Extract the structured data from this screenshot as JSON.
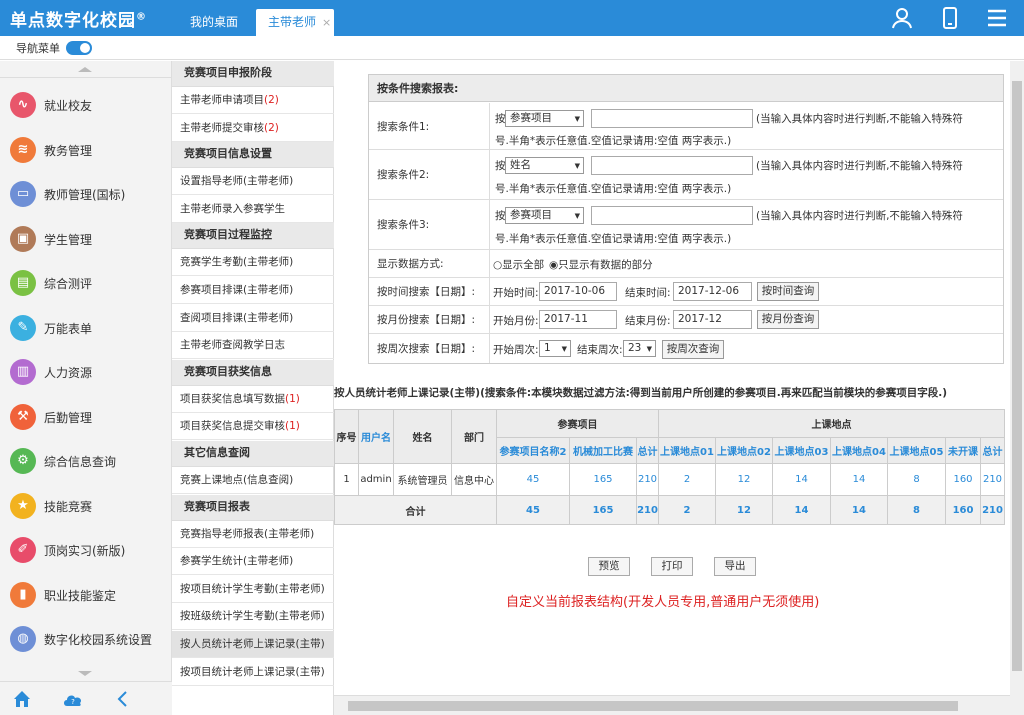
{
  "header": {
    "app_name": "单点数字化校园",
    "reg_mark": "®",
    "tabs": [
      {
        "label": "我的桌面"
      },
      {
        "label": "主带老师",
        "close": "×"
      }
    ],
    "icons": [
      "user-icon",
      "phone-icon",
      "menu-icon"
    ],
    "accent": "#2a8bd8"
  },
  "subbar": {
    "nav_label": "导航菜单"
  },
  "sidebar": {
    "items": [
      {
        "label": "就业校友",
        "icon": "chart-line-icon",
        "color": "#e8566b"
      },
      {
        "label": "教务管理",
        "icon": "layers-icon",
        "color": "#f07a3a"
      },
      {
        "label": "教师管理(国标)",
        "icon": "book-icon",
        "color": "#6e8fd6"
      },
      {
        "label": "学生管理",
        "icon": "student-icon",
        "color": "#b07a58"
      },
      {
        "label": "综合测评",
        "icon": "clipboard-icon",
        "color": "#7ac143"
      },
      {
        "label": "万能表单",
        "icon": "form-icon",
        "color": "#3bb0e0"
      },
      {
        "label": "人力资源",
        "icon": "briefcase-icon",
        "color": "#b36bd0"
      },
      {
        "label": "后勤管理",
        "icon": "wrench-icon",
        "color": "#f0623a"
      },
      {
        "label": "综合信息查询",
        "icon": "gear-icon",
        "color": "#56b854"
      },
      {
        "label": "技能竞赛",
        "icon": "medal-icon",
        "color": "#f2b21f"
      },
      {
        "label": "顶岗实习(新版)",
        "icon": "edit-icon",
        "color": "#e84c6a"
      },
      {
        "label": "职业技能鉴定",
        "icon": "bar-chart-icon",
        "color": "#f07a3a"
      },
      {
        "label": "数字化校园系统设置",
        "icon": "settings-icon",
        "color": "#6e8fd6"
      }
    ],
    "footer_icons": [
      "home-icon",
      "cloud-help-icon",
      "collapse-icon"
    ]
  },
  "submenu": {
    "groups": [
      {
        "title": "竞赛项目申报阶段",
        "items": [
          {
            "label": "主带老师申请项目",
            "count": "(2)"
          },
          {
            "label": "主带老师提交审核",
            "count": "(2)"
          }
        ]
      },
      {
        "title": "竞赛项目信息设置",
        "items": [
          {
            "label": "设置指导老师(主带老师)",
            "count": ""
          },
          {
            "label": "主带老师录入参赛学生",
            "count": ""
          }
        ]
      },
      {
        "title": "竞赛项目过程监控",
        "items": [
          {
            "label": "竞赛学生考勤(主带老师)",
            "count": ""
          },
          {
            "label": "参赛项目排课(主带老师)",
            "count": ""
          },
          {
            "label": "查阅项目排课(主带老师)",
            "count": ""
          },
          {
            "label": "主带老师查阅教学日志",
            "count": ""
          }
        ]
      },
      {
        "title": "竞赛项目获奖信息",
        "items": [
          {
            "label": "项目获奖信息填写数据",
            "count": "(1)"
          },
          {
            "label": "项目获奖信息提交审核",
            "count": "(1)"
          }
        ]
      },
      {
        "title": "其它信息查阅",
        "items": [
          {
            "label": "竞赛上课地点(信息查阅)",
            "count": ""
          }
        ]
      },
      {
        "title": "竞赛项目报表",
        "items": [
          {
            "label": "竞赛指导老师报表(主带老师)",
            "count": ""
          },
          {
            "label": "参赛学生统计(主带老师)",
            "count": ""
          },
          {
            "label": "按项目统计学生考勤(主带老师)",
            "count": ""
          },
          {
            "label": "按班级统计学生考勤(主带老师)",
            "count": ""
          },
          {
            "label": "按人员统计老师上课记录(主带)",
            "count": "",
            "active": true
          },
          {
            "label": "按项目统计老师上课记录(主带)",
            "count": ""
          }
        ]
      }
    ]
  },
  "search": {
    "title": "按条件搜索报表:",
    "conditions": [
      {
        "label": "搜索条件1:",
        "prefix": "按",
        "field": "参赛项目",
        "value": "",
        "hint": "(当输入具体内容时进行判断,不能输入特殊符",
        "hint2": "号.半角*表示任意值.空值记录请用:空值 两字表示.)"
      },
      {
        "label": "搜索条件2:",
        "prefix": "按",
        "field": "姓名",
        "value": "",
        "hint": "(当输入具体内容时进行判断,不能输入特殊符",
        "hint2": "号.半角*表示任意值.空值记录请用:空值 两字表示.)"
      },
      {
        "label": "搜索条件3:",
        "prefix": "按",
        "field": "参赛项目",
        "value": "",
        "hint": "(当输入具体内容时进行判断,不能输入特殊符",
        "hint2": "号.半角*表示任意值.空值记录请用:空值 两字表示.)"
      }
    ],
    "display_mode": {
      "label": "显示数据方式:",
      "opt_all": "显示全部",
      "opt_data": "只显示有数据的部分",
      "selected": "opt_data"
    },
    "time": {
      "label": "按时间搜索【日期】:",
      "start_label": "开始时间:",
      "start": "2017-10-06",
      "end_label": "结束时间:",
      "end": "2017-12-06",
      "button": "按时间查询"
    },
    "month": {
      "label": "按月份搜索【日期】:",
      "start_label": "开始月份:",
      "start": "2017-11",
      "end_label": "结束月份:",
      "end": "2017-12",
      "button": "按月份查询"
    },
    "week": {
      "label": "按周次搜索【日期】:",
      "start_label": "开始周次:",
      "start": "1",
      "end_label": "结束周次:",
      "end": "23",
      "button": "按周次查询"
    }
  },
  "report": {
    "notice": "按人员统计老师上课记录(主带)(搜索条件:本模块数据过滤方法:得到当前用户所创建的参赛项目.再来匹配当前模块的参赛项目字段.)",
    "group_headers": [
      "参赛项目",
      "上课地点"
    ],
    "columns": [
      "序号",
      "用户名",
      "姓名",
      "部门"
    ],
    "sub_columns": [
      "参赛项目名称2",
      "机械加工比赛",
      "总计",
      "上课地点01",
      "上课地点02",
      "上课地点03",
      "上课地点04",
      "上课地点05",
      "未开课",
      "总计"
    ],
    "rows": [
      {
        "no": "1",
        "user": "admin",
        "name": "系统管理员",
        "dept": "信息中心",
        "values": [
          "45",
          "165",
          "210",
          "2",
          "12",
          "14",
          "14",
          "8",
          "160",
          "210"
        ]
      }
    ],
    "total": {
      "label": "合计",
      "values": [
        "45",
        "165",
        "210",
        "2",
        "12",
        "14",
        "14",
        "8",
        "160",
        "210"
      ]
    }
  },
  "actions": [
    "预览",
    "打印",
    "导出"
  ],
  "custom_link": "自定义当前报表结构(开发人员专用,普通用户无须使用)"
}
